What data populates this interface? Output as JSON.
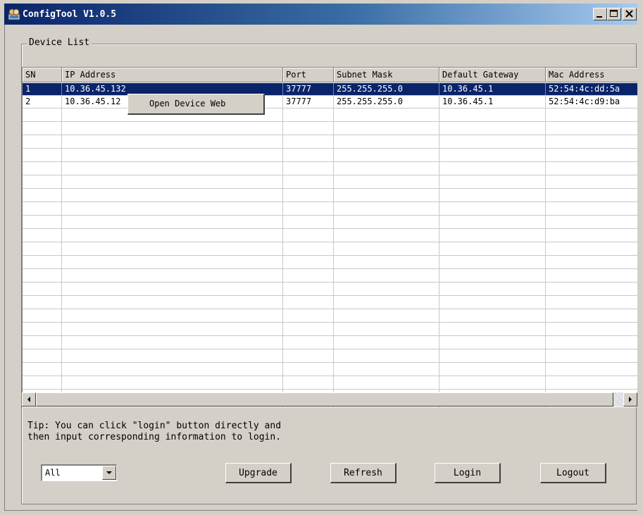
{
  "window": {
    "title": "ConfigTool V1.0.5",
    "icon": "app-icon"
  },
  "titlebar_buttons": [
    {
      "name": "minimize-button",
      "icon": "minimize-icon"
    },
    {
      "name": "maximize-button",
      "icon": "maximize-icon"
    },
    {
      "name": "close-button",
      "icon": "close-icon"
    }
  ],
  "device_list": {
    "legend": "Device List",
    "columns": [
      "SN",
      "IP Address",
      "Port",
      "Subnet Mask",
      "Default Gateway",
      "Mac Address"
    ],
    "rows": [
      [
        "1",
        "10.36.45.132",
        "37777",
        "255.255.255.0",
        "10.36.45.1",
        "52:54:4c:dd:5a"
      ],
      [
        "2",
        "10.36.45.12",
        "37777",
        "255.255.255.0",
        "10.36.45.1",
        "52:54:4c:d9:ba"
      ]
    ],
    "selected_row": 0,
    "empty_rows": 23
  },
  "context_menu": {
    "item": "Open Device Web"
  },
  "tip": "Tip: You can click \"login\" button directly and\nthen input corresponding information to login.",
  "filter": {
    "selected": "All"
  },
  "buttons": {
    "upgrade": "Upgrade",
    "refresh": "Refresh",
    "login": "Login",
    "logout": "Logout"
  },
  "colors": {
    "title_start": "#0a246a",
    "title_end": "#a6caf0",
    "selection": "#0a246a",
    "face": "#d4d0c8"
  }
}
